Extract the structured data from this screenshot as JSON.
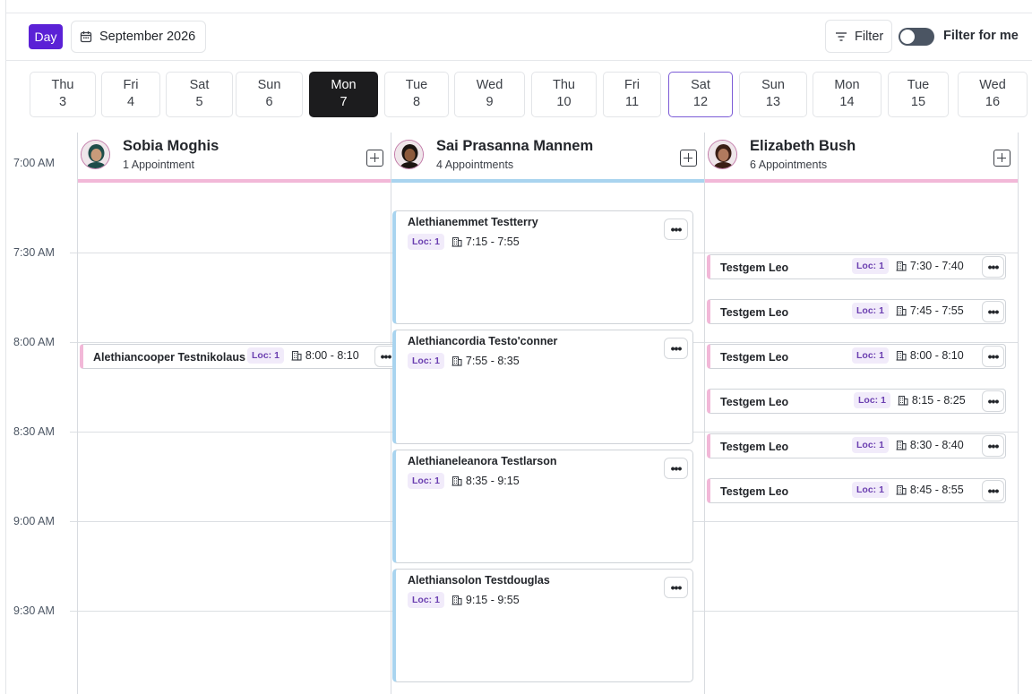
{
  "toolbar": {
    "view_label": "Day",
    "month_label": "September 2026",
    "filter_label": "Filter",
    "filter_for_me_label": "Filter for me",
    "filter_for_me_on": false
  },
  "date_strip": [
    {
      "weekday": "Thu",
      "day": "3"
    },
    {
      "weekday": "Fri",
      "day": "4"
    },
    {
      "weekday": "Sat",
      "day": "5"
    },
    {
      "weekday": "Sun",
      "day": "6"
    },
    {
      "weekday": "Mon",
      "day": "7",
      "selected": true
    },
    {
      "weekday": "Tue",
      "day": "8"
    },
    {
      "weekday": "Wed",
      "day": "9"
    },
    {
      "weekday": "Thu",
      "day": "10"
    },
    {
      "weekday": "Fri",
      "day": "11"
    },
    {
      "weekday": "Sat",
      "day": "12",
      "today": true
    },
    {
      "weekday": "Sun",
      "day": "13"
    },
    {
      "weekday": "Mon",
      "day": "14"
    },
    {
      "weekday": "Tue",
      "day": "15"
    },
    {
      "weekday": "Wed",
      "day": "16"
    }
  ],
  "time_labels": [
    "7:00 AM",
    "7:30 AM",
    "8:00 AM",
    "8:30 AM",
    "9:00 AM",
    "9:30 AM"
  ],
  "staff": [
    {
      "name": "Sobia Moghis",
      "count": "1 Appointment",
      "accent": "#f2b8d8",
      "appointments": [
        {
          "title": "Alethiancooper Testnikolaus",
          "loc": "Loc: 1",
          "time": "8:00 - 8:10"
        }
      ]
    },
    {
      "name": "Sai Prasanna Mannem",
      "count": "4 Appointments",
      "accent": "#a9d4ef",
      "appointments": [
        {
          "title": "Alethianemmet Testterry",
          "loc": "Loc: 1",
          "time": "7:15 - 7:55"
        },
        {
          "title": "Alethiancordia Testo'conner",
          "loc": "Loc: 1",
          "time": "7:55 - 8:35"
        },
        {
          "title": "Alethianeleanora Testlarson",
          "loc": "Loc: 1",
          "time": "8:35 - 9:15"
        },
        {
          "title": "Alethiansolon Testdouglas",
          "loc": "Loc: 1",
          "time": "9:15 - 9:55"
        }
      ]
    },
    {
      "name": "Elizabeth Bush",
      "count": "6 Appointments",
      "accent": "#f2b8d8",
      "appointments": [
        {
          "title": "Testgem Leo",
          "loc": "Loc: 1",
          "time": "7:30 - 7:40"
        },
        {
          "title": "Testgem Leo",
          "loc": "Loc: 1",
          "time": "7:45 - 7:55"
        },
        {
          "title": "Testgem Leo",
          "loc": "Loc: 1",
          "time": "8:00 - 8:10"
        },
        {
          "title": "Testgem Leo",
          "loc": "Loc: 1",
          "time": "8:15 - 8:25"
        },
        {
          "title": "Testgem Leo",
          "loc": "Loc: 1",
          "time": "8:30 - 8:40"
        },
        {
          "title": "Testgem Leo",
          "loc": "Loc: 1",
          "time": "8:45 - 8:55"
        }
      ]
    }
  ],
  "more_glyph": "•••",
  "colors": {
    "primary": "#5b21d6",
    "selected_day": "#1c1c1e",
    "today_border": "#7c5cd6"
  }
}
